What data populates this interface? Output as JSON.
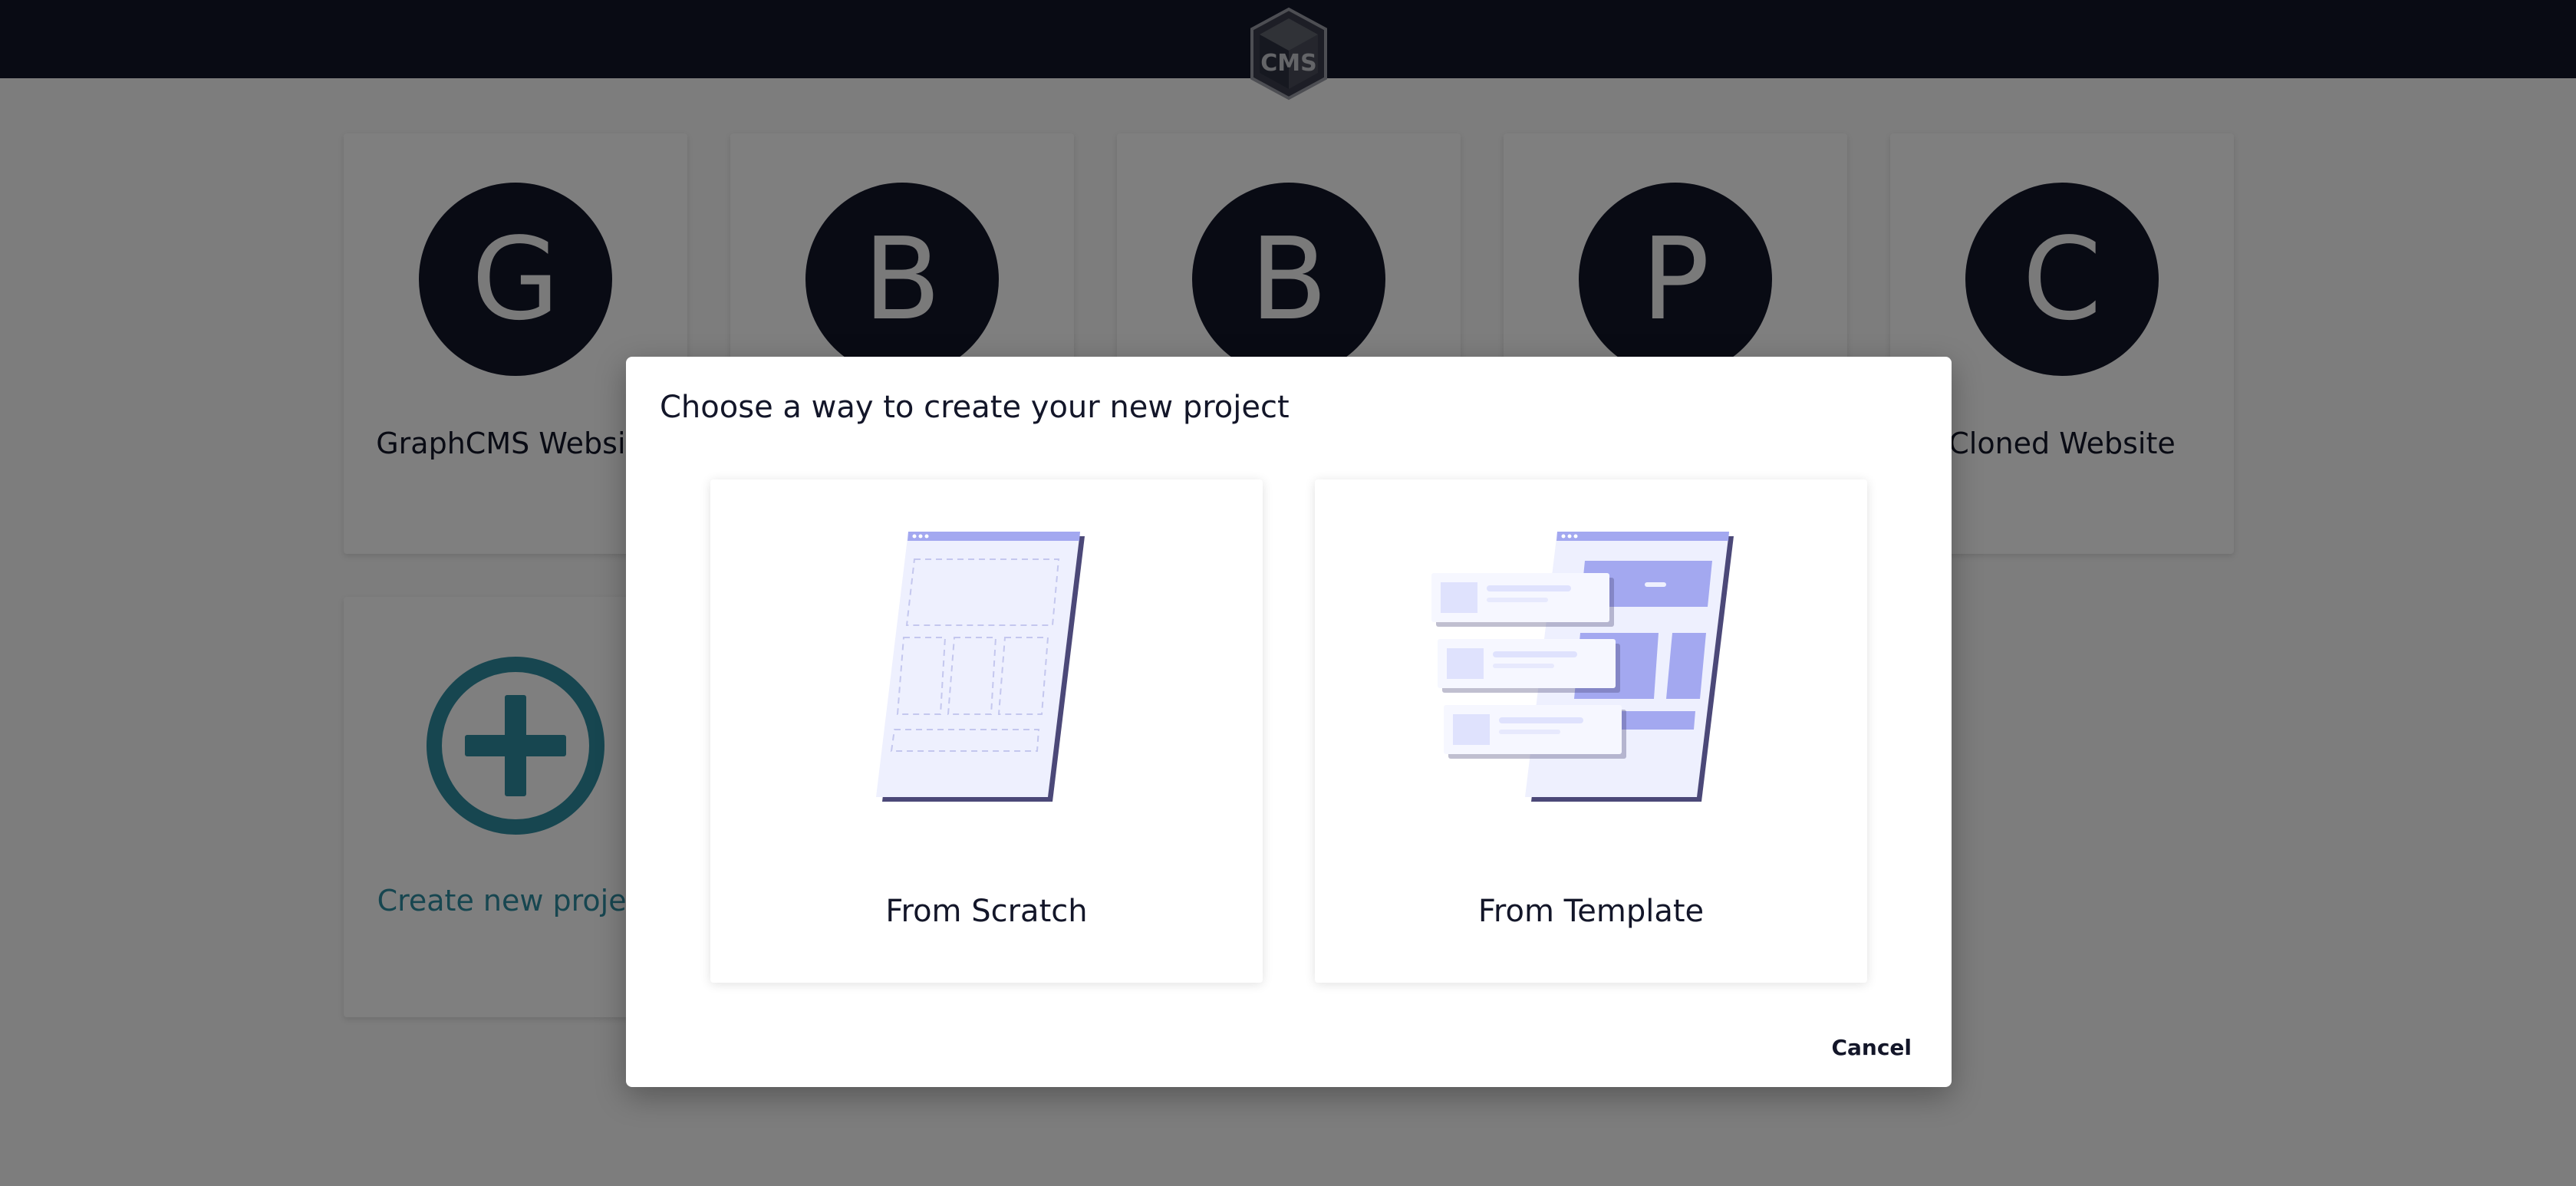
{
  "app": {
    "logo_icon": "graphcms-cube-logo"
  },
  "colors": {
    "topbar": "#131629",
    "avatar_bg": "#131629",
    "accent_teal": "#2e8da1",
    "illustration_purple": "#a3a8f0"
  },
  "projects": [
    {
      "initial": "G",
      "name": "GraphCMS Website"
    },
    {
      "initial": "B",
      "name": ""
    },
    {
      "initial": "B",
      "name": ""
    },
    {
      "initial": "P",
      "name": ""
    },
    {
      "initial": "C",
      "name": "Cloned Website"
    }
  ],
  "create_card": {
    "label": "Create new project",
    "icon": "plus-circle-icon"
  },
  "modal": {
    "title": "Choose a way to create your new project",
    "options": [
      {
        "label": "From Scratch",
        "illustration": "blank-page-wireframe"
      },
      {
        "label": "From Template",
        "illustration": "template-page-with-cards"
      }
    ],
    "cancel_label": "Cancel"
  }
}
